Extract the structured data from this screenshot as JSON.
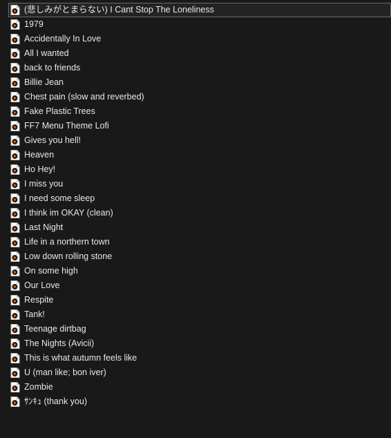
{
  "files": [
    "(悲しみがとまらない) I Cant Stop The Loneliness",
    "1979",
    "Accidentally In Love",
    "All I wanted",
    "back to friends",
    "Billie Jean",
    "Chest pain (slow and reverbed)",
    "Fake Plastic Trees",
    "FF7 Menu Theme Lofi",
    "Gives you hell!",
    "Heaven",
    "Ho Hey!",
    "I miss you",
    "I need some sleep",
    "I think im OKAY (clean)",
    "Last Night",
    "Life in a northern town",
    "Low down rolling stone",
    "On some high",
    "Our Love",
    "Respite",
    "Tank!",
    "Teenage dirtbag",
    "The Nights (Avicii)",
    "This is what autumn feels like",
    "U (man like; bon iver)",
    "Zombie",
    "ｻﾝｷｭ (thank you)"
  ],
  "selected_index": 0,
  "icon": "audio-file-icon",
  "colors": {
    "background": "#191919",
    "text": "#e8e8e8",
    "selection_border": "#6b6b6b"
  }
}
